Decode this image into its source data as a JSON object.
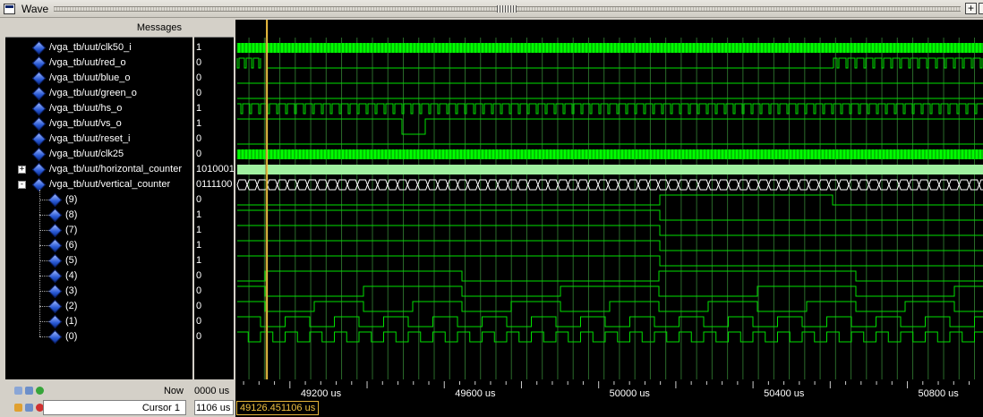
{
  "window": {
    "title": "Wave",
    "buttons": [
      "+"
    ]
  },
  "header": {
    "messages_label": "Messages"
  },
  "signals": [
    {
      "name": "/vga_tb/uut/clk50_i",
      "value": "1",
      "kind": "clock",
      "period": 2,
      "expander": ""
    },
    {
      "name": "/vga_tb/uut/red_o",
      "value": "0",
      "kind": "red",
      "expander": ""
    },
    {
      "name": "/vga_tb/uut/blue_o",
      "value": "0",
      "kind": "low",
      "expander": ""
    },
    {
      "name": "/vga_tb/uut/green_o",
      "value": "0",
      "kind": "low",
      "expander": ""
    },
    {
      "name": "/vga_tb/uut/hs_o",
      "value": "1",
      "kind": "hs",
      "expander": ""
    },
    {
      "name": "/vga_tb/uut/vs_o",
      "value": "1",
      "kind": "vs",
      "expander": ""
    },
    {
      "name": "/vga_tb/uut/reset_i",
      "value": "0",
      "kind": "low",
      "expander": ""
    },
    {
      "name": "/vga_tb/uut/clk25",
      "value": "0",
      "kind": "clock",
      "period": 4,
      "expander": ""
    },
    {
      "name": "/vga_tb/uut/horizontal_counter",
      "value": "1010001",
      "kind": "busfill",
      "expander": "+"
    },
    {
      "name": "/vga_tb/uut/vertical_counter",
      "value": "0111100",
      "kind": "bus",
      "expander": "-"
    },
    {
      "name": "(9)",
      "value": "0",
      "kind": "vbit",
      "bit": 9,
      "expander": ""
    },
    {
      "name": "(8)",
      "value": "1",
      "kind": "vbit",
      "bit": 8,
      "expander": ""
    },
    {
      "name": "(7)",
      "value": "1",
      "kind": "vbit",
      "bit": 7,
      "expander": ""
    },
    {
      "name": "(6)",
      "value": "1",
      "kind": "vbit",
      "bit": 6,
      "expander": ""
    },
    {
      "name": "(5)",
      "value": "1",
      "kind": "vbit",
      "bit": 5,
      "expander": ""
    },
    {
      "name": "(4)",
      "value": "0",
      "kind": "vbit",
      "bit": 4,
      "expander": ""
    },
    {
      "name": "(3)",
      "value": "0",
      "kind": "vbit",
      "bit": 3,
      "expander": ""
    },
    {
      "name": "(2)",
      "value": "0",
      "kind": "vbit",
      "bit": 2,
      "expander": ""
    },
    {
      "name": "(1)",
      "value": "0",
      "kind": "vbit",
      "bit": 1,
      "expander": ""
    },
    {
      "name": "(0)",
      "value": "0",
      "kind": "vbit",
      "bit": 0,
      "expander": ""
    }
  ],
  "timeline": {
    "unit": "us",
    "tick_labels": [
      "49200 us",
      "49600 us",
      "50000 us",
      "50400 us",
      "50800 us"
    ],
    "tick_values": [
      49200,
      49600,
      50000,
      50400,
      50800
    ],
    "view_start": 49045,
    "view_end": 50982
  },
  "status": {
    "now_label": "Now",
    "now_value": "0000 us",
    "cursor_label": "Cursor 1",
    "cursor_value": "1106 us",
    "cursor_time_text": "49126.451106 us",
    "cursor_time": 49126.451106
  },
  "colors": {
    "wave": "#00e000",
    "clock_fill": "#00ff00",
    "bus_fill": "#a0f0a0",
    "cursor": "#f0c040",
    "grid": "#2a6a2a",
    "red_marker": "#ff3030"
  }
}
